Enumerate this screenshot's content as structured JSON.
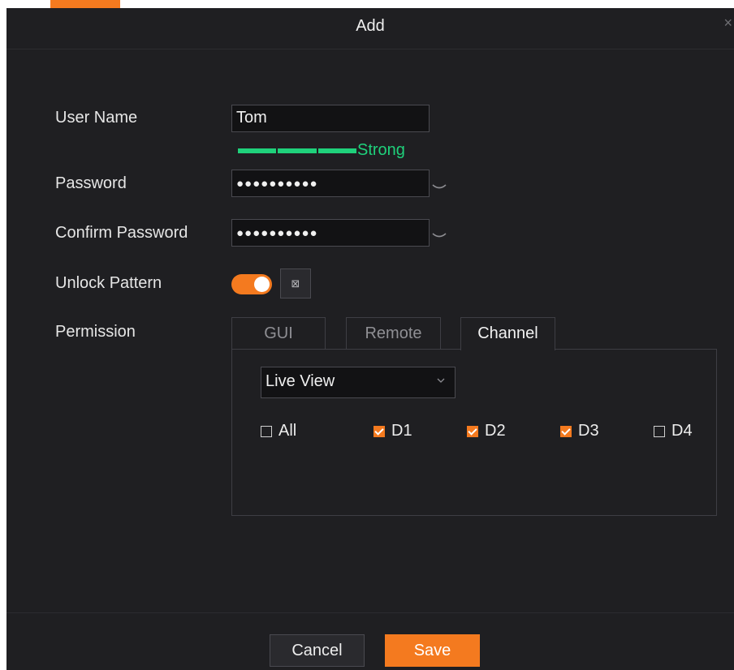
{
  "dialog": {
    "title": "Add",
    "close_icon": "×"
  },
  "form": {
    "user_name_label": "User Name",
    "user_name_value": "Tom",
    "strength_label": "Strong",
    "password_label": "Password",
    "password_value": "●●●●●●●●●●",
    "confirm_label": "Confirm Password",
    "confirm_value": "●●●●●●●●●●",
    "unlock_label": "Unlock Pattern",
    "unlock_enabled": true,
    "pattern_icon": "⊠",
    "permission_label": "Permission"
  },
  "tabs": [
    {
      "label": "GUI"
    },
    {
      "label": "Remote"
    },
    {
      "label": "Channel",
      "active": true
    }
  ],
  "channel": {
    "view_select": "Live View",
    "items": [
      {
        "label": "All",
        "checked": false
      },
      {
        "label": "D1",
        "checked": true
      },
      {
        "label": "D2",
        "checked": true
      },
      {
        "label": "D3",
        "checked": true
      },
      {
        "label": "D4",
        "checked": false
      }
    ]
  },
  "footer": {
    "cancel_label": "Cancel",
    "save_label": "Save"
  },
  "colors": {
    "accent": "#f47a1f",
    "strength": "#1fd17b",
    "background": "#1f1f22"
  }
}
